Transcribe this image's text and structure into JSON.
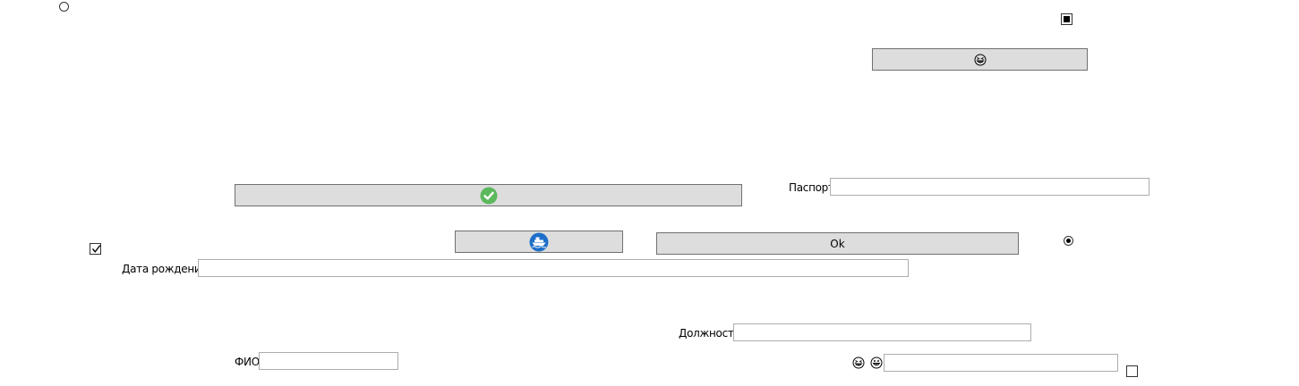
{
  "buttons": {
    "emoji_button": {
      "icon": "grinning-squint-emoji-icon"
    },
    "check_button": {
      "icon": "check-circle-icon",
      "accent": "#5cb85c"
    },
    "ship_button": {
      "icon": "ship-icon",
      "accent": "#1e6fc9"
    },
    "ok_button": {
      "label": "Ok"
    }
  },
  "fields": {
    "passport": {
      "label": "Паспорт",
      "value": ""
    },
    "birth_date": {
      "label": "Дата рождения",
      "value": ""
    },
    "position": {
      "label": "Должность",
      "value": ""
    },
    "full_name": {
      "label": "ФИО",
      "value": ""
    },
    "emoji_field": {
      "value": "",
      "icons": [
        "grinning-squint-emoji-icon",
        "grinning-emoji-icon"
      ]
    }
  },
  "controls": {
    "radio_top_left": {
      "checked": false
    },
    "radio_right": {
      "checked": true
    },
    "checkbox_top_right": {
      "state": "indeterminate"
    },
    "checkbox_left": {
      "state": "checked"
    },
    "checkbox_bottom_right": {
      "state": "unchecked"
    }
  },
  "colors": {
    "button_face": "#dddddd",
    "button_border": "#707070",
    "input_border": "#adadad"
  }
}
